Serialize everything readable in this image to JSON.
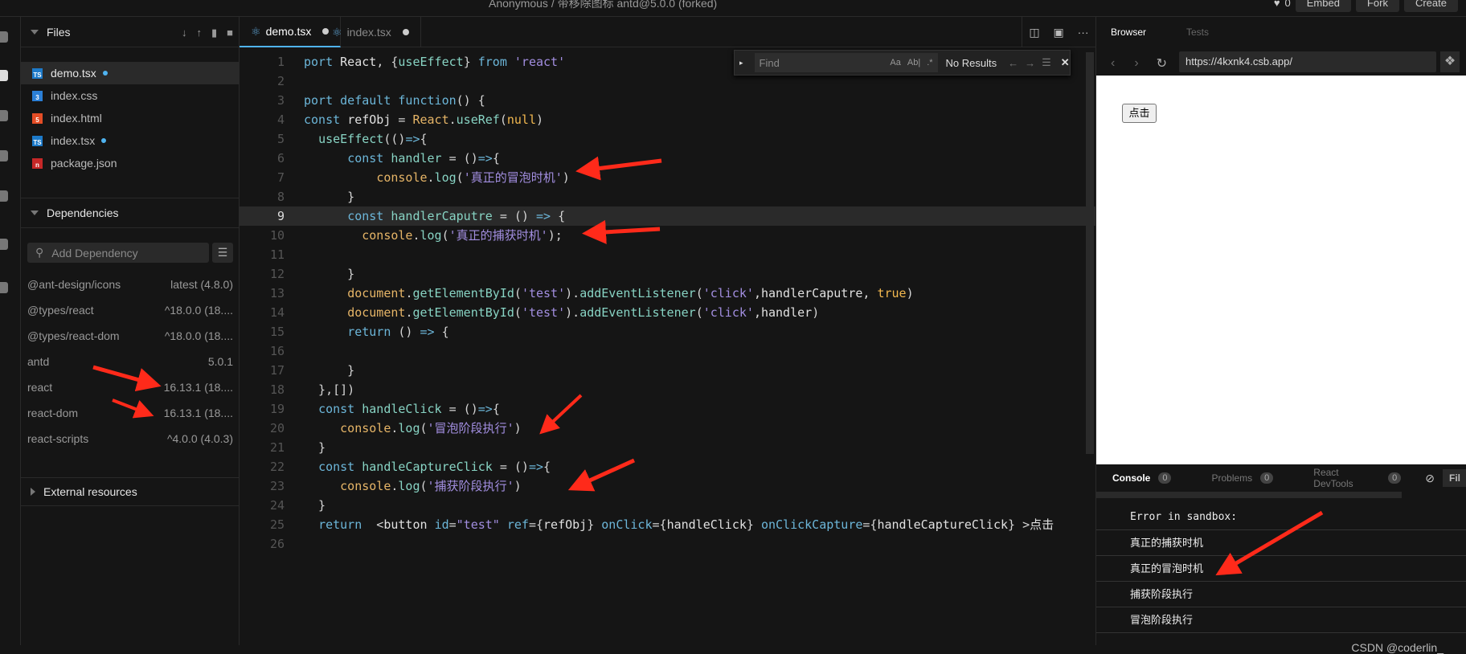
{
  "topbar": {
    "title": "Anonymous / 带移除图标 antd@5.0.0 (forked)",
    "likes": "0",
    "embed": "Embed",
    "fork": "Fork",
    "create": "Create"
  },
  "files": {
    "header": "Files",
    "items": [
      {
        "name": "demo.tsx",
        "type": "ts",
        "modified": true,
        "active": true
      },
      {
        "name": "index.css",
        "type": "css",
        "modified": false
      },
      {
        "name": "index.html",
        "type": "html",
        "modified": false
      },
      {
        "name": "index.tsx",
        "type": "ts",
        "modified": true
      },
      {
        "name": "package.json",
        "type": "npm",
        "modified": false
      }
    ]
  },
  "dependencies": {
    "header": "Dependencies",
    "placeholder": "Add Dependency",
    "items": [
      {
        "name": "@ant-design/icons",
        "version": "latest (4.8.0)"
      },
      {
        "name": "@types/react",
        "version": "^18.0.0 (18...."
      },
      {
        "name": "@types/react-dom",
        "version": "^18.0.0 (18...."
      },
      {
        "name": "antd",
        "version": "5.0.1"
      },
      {
        "name": "react",
        "version": "16.13.1 (18...."
      },
      {
        "name": "react-dom",
        "version": "16.13.1 (18...."
      },
      {
        "name": "react-scripts",
        "version": "^4.0.0 (4.0.3)"
      }
    ]
  },
  "external": {
    "header": "External resources"
  },
  "editor": {
    "tabs": [
      {
        "label": "demo.tsx",
        "active": true
      },
      {
        "label": "index.tsx",
        "active": false
      }
    ],
    "find": {
      "placeholder": "Find",
      "result": "No Results"
    },
    "current_line": 9,
    "lines": [
      [
        [
          "kw",
          "port "
        ],
        [
          "id",
          "React"
        ],
        [
          "pn",
          ", {"
        ],
        [
          "fn",
          "useEffect"
        ],
        [
          "pn",
          "} "
        ],
        [
          "kw",
          "from "
        ],
        [
          "st",
          "'react'"
        ]
      ],
      [],
      [
        [
          "kw",
          "port default function"
        ],
        [
          "pn",
          "() {"
        ]
      ],
      [
        [
          "kw",
          "const "
        ],
        [
          "id",
          "refObj"
        ],
        [
          "pn",
          " = "
        ],
        [
          "ob",
          "React"
        ],
        [
          "pn",
          "."
        ],
        [
          "fn",
          "useRef"
        ],
        [
          "pn",
          "("
        ],
        [
          "bo",
          "null"
        ],
        [
          "pn",
          ")"
        ]
      ],
      [
        [
          "pn",
          "  "
        ],
        [
          "fn",
          "useEffect"
        ],
        [
          "pn",
          "(()"
        ],
        [
          "kw",
          "=>"
        ],
        [
          "pn",
          "{"
        ]
      ],
      [
        [
          "pn",
          "      "
        ],
        [
          "kw",
          "const "
        ],
        [
          "fn",
          "handler"
        ],
        [
          "pn",
          " = ()"
        ],
        [
          "kw",
          "=>"
        ],
        [
          "pn",
          "{"
        ]
      ],
      [
        [
          "pn",
          "          "
        ],
        [
          "ob",
          "console"
        ],
        [
          "pn",
          "."
        ],
        [
          "fn",
          "log"
        ],
        [
          "pn",
          "("
        ],
        [
          "st",
          "'真正的冒泡时机'"
        ],
        [
          "pn",
          ")"
        ]
      ],
      [
        [
          "pn",
          "      }"
        ]
      ],
      [
        [
          "pn",
          "      "
        ],
        [
          "kw",
          "const "
        ],
        [
          "fn",
          "handlerCaputre"
        ],
        [
          "pn",
          " = () "
        ],
        [
          "kw",
          "=>"
        ],
        [
          "pn",
          " {"
        ]
      ],
      [
        [
          "pn",
          "        "
        ],
        [
          "ob",
          "console"
        ],
        [
          "pn",
          "."
        ],
        [
          "fn",
          "log"
        ],
        [
          "pn",
          "("
        ],
        [
          "st",
          "'真正的捕获时机'"
        ],
        [
          "pn",
          ");"
        ]
      ],
      [],
      [
        [
          "pn",
          "      }"
        ]
      ],
      [
        [
          "pn",
          "      "
        ],
        [
          "ob",
          "document"
        ],
        [
          "pn",
          "."
        ],
        [
          "fn",
          "getElementById"
        ],
        [
          "pn",
          "("
        ],
        [
          "st",
          "'test'"
        ],
        [
          "pn",
          ")."
        ],
        [
          "fn",
          "addEventListener"
        ],
        [
          "pn",
          "("
        ],
        [
          "st",
          "'click'"
        ],
        [
          "id",
          ",handlerCaputre, "
        ],
        [
          "bo",
          "true"
        ],
        [
          "pn",
          ")"
        ]
      ],
      [
        [
          "pn",
          "      "
        ],
        [
          "ob",
          "document"
        ],
        [
          "pn",
          "."
        ],
        [
          "fn",
          "getElementById"
        ],
        [
          "pn",
          "("
        ],
        [
          "st",
          "'test'"
        ],
        [
          "pn",
          ")."
        ],
        [
          "fn",
          "addEventListener"
        ],
        [
          "pn",
          "("
        ],
        [
          "st",
          "'click'"
        ],
        [
          "id",
          ",handler"
        ],
        [
          "pn",
          ")"
        ]
      ],
      [
        [
          "pn",
          "      "
        ],
        [
          "kw",
          "return"
        ],
        [
          "pn",
          " () "
        ],
        [
          "kw",
          "=>"
        ],
        [
          "pn",
          " {"
        ]
      ],
      [],
      [
        [
          "pn",
          "      }"
        ]
      ],
      [
        [
          "pn",
          "  },[])"
        ]
      ],
      [
        [
          "pn",
          "  "
        ],
        [
          "kw",
          "const "
        ],
        [
          "fn",
          "handleClick"
        ],
        [
          "pn",
          " = ()"
        ],
        [
          "kw",
          "=>"
        ],
        [
          "pn",
          "{"
        ]
      ],
      [
        [
          "pn",
          "     "
        ],
        [
          "ob",
          "console"
        ],
        [
          "pn",
          "."
        ],
        [
          "fn",
          "log"
        ],
        [
          "pn",
          "("
        ],
        [
          "st",
          "'冒泡阶段执行'"
        ],
        [
          "pn",
          ")"
        ]
      ],
      [
        [
          "pn",
          "  }"
        ]
      ],
      [
        [
          "pn",
          "  "
        ],
        [
          "kw",
          "const "
        ],
        [
          "fn",
          "handleCaptureClick"
        ],
        [
          "pn",
          " = ()"
        ],
        [
          "kw",
          "=>"
        ],
        [
          "pn",
          "{"
        ]
      ],
      [
        [
          "pn",
          "     "
        ],
        [
          "ob",
          "console"
        ],
        [
          "pn",
          "."
        ],
        [
          "fn",
          "log"
        ],
        [
          "pn",
          "("
        ],
        [
          "st",
          "'捕获阶段执行'"
        ],
        [
          "pn",
          ")"
        ]
      ],
      [
        [
          "pn",
          "  }"
        ]
      ],
      [
        [
          "pn",
          "  "
        ],
        [
          "kw",
          "return"
        ],
        [
          "pn",
          "  <"
        ],
        [
          "id",
          "button "
        ],
        [
          "kw",
          "id"
        ],
        [
          "pn",
          "="
        ],
        [
          "st",
          "\"test\" "
        ],
        [
          "kw",
          "ref"
        ],
        [
          "pn",
          "={"
        ],
        [
          "id",
          "refObj"
        ],
        [
          "pn",
          "} "
        ],
        [
          "kw",
          "onClick"
        ],
        [
          "pn",
          "={"
        ],
        [
          "id",
          "handleClick"
        ],
        [
          "pn",
          "} "
        ],
        [
          "kw",
          "onClickCapture"
        ],
        [
          "pn",
          "={"
        ],
        [
          "id",
          "handleCaptureClick"
        ],
        [
          "pn",
          "} >"
        ],
        [
          "id",
          "点击"
        ]
      ],
      []
    ]
  },
  "preview": {
    "tabs": [
      "Browser",
      "Tests"
    ],
    "url": "https://4kxnk4.csb.app/",
    "button": "点击"
  },
  "console": {
    "tabs": [
      {
        "label": "Console",
        "count": "0"
      },
      {
        "label": "Problems",
        "count": "0"
      },
      {
        "label": "React DevTools",
        "count": "0"
      }
    ],
    "filter": "Fil",
    "rows": [
      "Error in sandbox:",
      "真正的捕获时机",
      "真正的冒泡时机",
      "捕获阶段执行",
      "冒泡阶段执行"
    ]
  },
  "watermark": "CSDN @coderlin_",
  "colors": {
    "accent": "#4fb3f0",
    "annotation": "#ff2a1a"
  }
}
